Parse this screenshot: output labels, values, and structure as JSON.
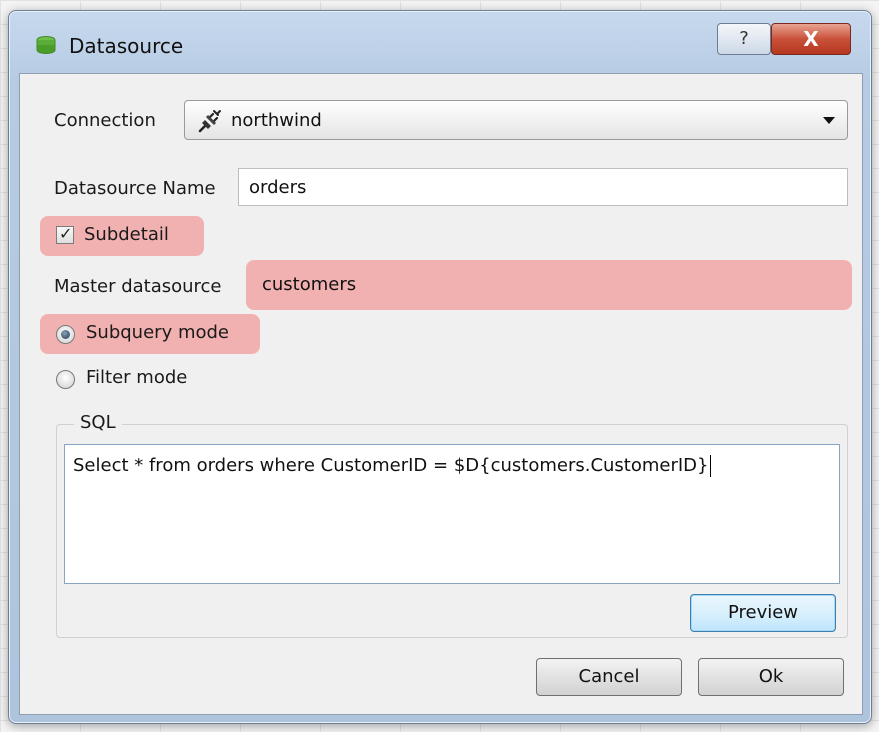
{
  "window": {
    "title": "Datasource",
    "help_label": "?",
    "close_label": "X"
  },
  "form": {
    "connection_label": "Connection",
    "connection_value": "northwind",
    "datasource_name_label": "Datasource Name",
    "datasource_name_value": "orders",
    "subdetail_label": "Subdetail",
    "subdetail_checked": true,
    "master_datasource_label": "Master datasource",
    "master_datasource_value": "customers",
    "subquery_mode_label": "Subquery mode",
    "filter_mode_label": "Filter mode",
    "selected_mode": "Subquery mode"
  },
  "sql": {
    "group_title": "SQL",
    "query": "Select * from orders where CustomerID = $D{customers.CustomerID}",
    "preview_label": "Preview"
  },
  "footer": {
    "cancel_label": "Cancel",
    "ok_label": "Ok"
  },
  "colors": {
    "highlight": "#f2a6a6",
    "title_bar": "#b6cbe3",
    "close_button": "#c9513a",
    "default_button_border": "#3c7fb1"
  },
  "icons": {
    "title": "database-icon",
    "connection": "plug-icon",
    "help": "help-icon",
    "close": "close-icon"
  }
}
